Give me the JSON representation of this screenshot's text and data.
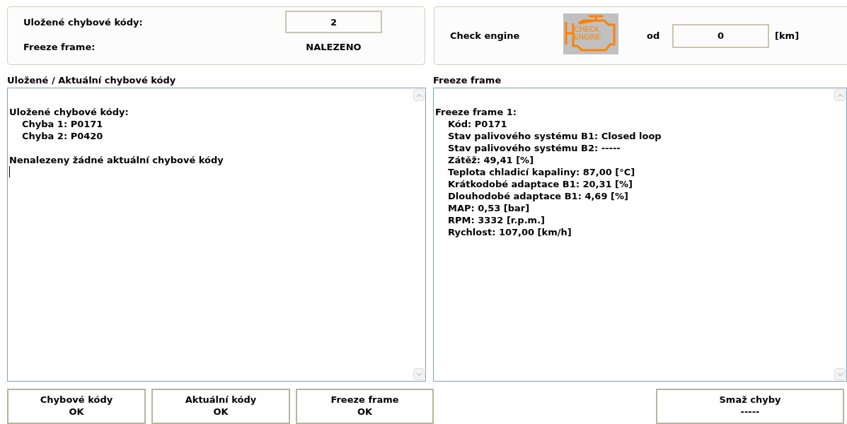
{
  "summary": {
    "stored_codes_label": "Uložené chybové kódy:",
    "stored_codes_value": "2",
    "freeze_frame_label": "Freeze frame:",
    "freeze_frame_value": "NALEZENO"
  },
  "check_engine": {
    "label": "Check engine",
    "icon_text": [
      "CHECK",
      "ENGINE"
    ],
    "from_label": "od",
    "value": "0",
    "unit": "[km]"
  },
  "left_panel": {
    "title": "Uložené / Aktuální chybové kódy",
    "lines": [
      {
        "text": "Uložené chybové kódy:",
        "children": [
          {
            "text": "Chyba 1: P0171"
          },
          {
            "text": "Chyba 2: P0420"
          }
        ]
      },
      {
        "text": "Nenalezeny žádné aktuální chybové kódy"
      }
    ]
  },
  "right_panel": {
    "title": "Freeze frame",
    "lines": [
      {
        "text": "Freeze frame 1:",
        "children": [
          {
            "text": "Kód: P0171"
          },
          {
            "text": "Stav palivového systému B1: Closed loop"
          },
          {
            "text": "Stav palivového systému B2: -----"
          },
          {
            "text": "Zátěž: 49,41 [%]"
          },
          {
            "text": "Teplota chladicí kapaliny: 87,00 [°C]"
          },
          {
            "text": "Krátkodobé adaptace B1: 20,31 [%]"
          },
          {
            "text": "Dlouhodobé adaptace B1: 4,69 [%]"
          },
          {
            "text": "MAP: 0,53 [bar]"
          },
          {
            "text": "RPM: 3332 [r.p.m.]"
          },
          {
            "text": "Rychlost: 107,00 [km/h]"
          }
        ]
      }
    ]
  },
  "buttons": [
    {
      "label": "Chybové kódy",
      "status": "OK"
    },
    {
      "label": "Aktuální kódy",
      "status": "OK"
    },
    {
      "label": "Freeze frame",
      "status": "OK"
    },
    {
      "label": "Smaž chyby",
      "status": "-----"
    }
  ]
}
